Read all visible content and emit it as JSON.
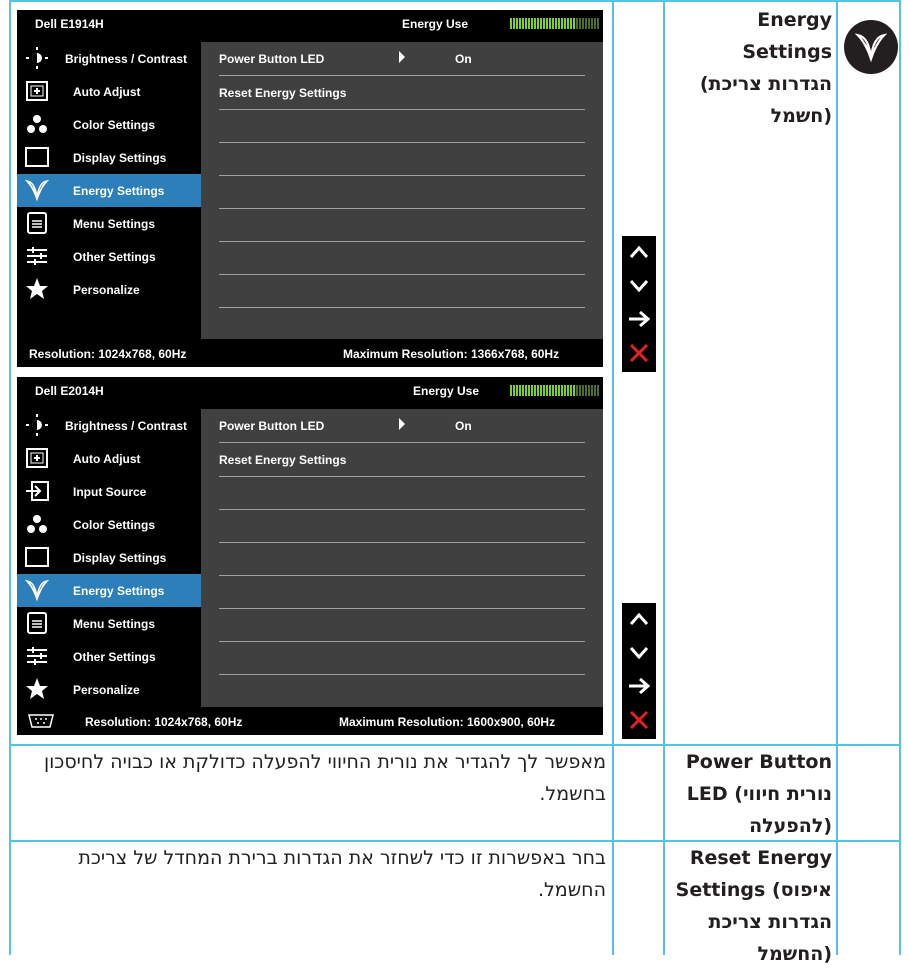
{
  "osd_panels": [
    {
      "model": "Dell E1914H",
      "energy_label": "Energy Use",
      "energy_level": 0.72,
      "menu": [
        {
          "label": "Brightness / Contrast",
          "icon": "brightness-icon",
          "active": false
        },
        {
          "label": "Auto Adjust",
          "icon": "auto-adjust-icon",
          "active": false
        },
        {
          "label": "Color Settings",
          "icon": "color-settings-icon",
          "active": false
        },
        {
          "label": "Display Settings",
          "icon": "display-settings-icon",
          "active": false
        },
        {
          "label": "Energy Settings",
          "icon": "energy-leaf-icon",
          "active": true
        },
        {
          "label": "Menu Settings",
          "icon": "menu-settings-icon",
          "active": false
        },
        {
          "label": "Other Settings",
          "icon": "other-settings-icon",
          "active": false
        },
        {
          "label": "Personalize",
          "icon": "star-icon",
          "active": false
        }
      ],
      "options": {
        "power_led": "Power Button LED",
        "power_led_value": "On",
        "reset": "Reset Energy Settings"
      },
      "resolution": "Resolution: 1024x768, 60Hz",
      "max_resolution": "Maximum Resolution: 1366x768, 60Hz"
    },
    {
      "model": "Dell E2014H",
      "energy_label": "Energy Use",
      "energy_level": 0.72,
      "menu": [
        {
          "label": "Brightness / Contrast",
          "icon": "brightness-icon",
          "active": false
        },
        {
          "label": "Auto Adjust",
          "icon": "auto-adjust-icon",
          "active": false
        },
        {
          "label": "Input Source",
          "icon": "input-source-icon",
          "active": false
        },
        {
          "label": "Color Settings",
          "icon": "color-settings-icon",
          "active": false
        },
        {
          "label": "Display Settings",
          "icon": "display-settings-icon",
          "active": false
        },
        {
          "label": "Energy Settings",
          "icon": "energy-leaf-icon",
          "active": true
        },
        {
          "label": "Menu Settings",
          "icon": "menu-settings-icon",
          "active": false
        },
        {
          "label": "Other Settings",
          "icon": "other-settings-icon",
          "active": false
        },
        {
          "label": "Personalize",
          "icon": "star-icon",
          "active": false
        }
      ],
      "options": {
        "power_led": "Power Button LED",
        "power_led_value": "On",
        "reset": "Reset Energy Settings"
      },
      "resolution": "Resolution: 1024x768, 60Hz",
      "max_resolution": "Maximum Resolution: 1600x900, 60Hz"
    }
  ],
  "nav_buttons": [
    "up-arrow-icon",
    "down-arrow-icon",
    "right-arrow-icon",
    "close-x-icon"
  ],
  "section": {
    "title_en_1": "Energy",
    "title_en_2": "Settings",
    "title_he_1": "(הגדרות צריכת",
    "title_he_2": "חשמל)",
    "icon": "energy-leaf-icon"
  },
  "rows": [
    {
      "title": [
        "Power Button",
        "LED (נורית חיווי",
        "להפעלה)"
      ],
      "desc": [
        "מאפשר לך להגדיר את נורית החיווי להפעלה כדולקת או כבויה לחיסכון",
        "בחשמל."
      ]
    },
    {
      "title": [
        "Reset Energy",
        "Settings (איפוס",
        "הגדרות צריכת",
        "החשמל)"
      ],
      "desc": [
        "בחר באפשרות זו כדי לשחזר את הגדרות ברירת המחדל של צריכת",
        "החשמל."
      ]
    }
  ],
  "colors": {
    "border": "#56c2e6",
    "osd_active": "#2c7fb8",
    "osd_content": "#404040",
    "meter_on": "#7fd320",
    "close_red": "#e62020"
  }
}
